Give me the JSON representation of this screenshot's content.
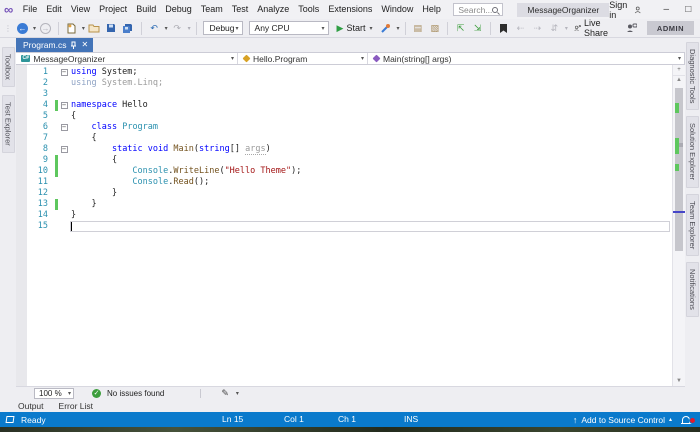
{
  "titlebar": {
    "menus": [
      "File",
      "Edit",
      "View",
      "Project",
      "Build",
      "Debug",
      "Team",
      "Test",
      "Analyze",
      "Tools",
      "Extensions",
      "Window",
      "Help"
    ],
    "search_placeholder": "Search...",
    "solution_badge": "MessageOrganizer",
    "sign_in_label": "Sign in",
    "window_controls": {
      "minimize": "–",
      "maximize": "□",
      "close": "×"
    }
  },
  "toolbar": {
    "config_dropdown": "Debug",
    "platform_dropdown": "Any CPU",
    "start_label": "Start",
    "live_share_label": "Live Share",
    "admin_label": "ADMIN"
  },
  "editor_tab": {
    "label": "Program.cs"
  },
  "navbar": {
    "project": "MessageOrganizer",
    "type": "Hello.Program",
    "member": "Main(string[] args)"
  },
  "side_tabs_left": [
    "Toolbox",
    "Test Explorer"
  ],
  "side_tabs_right": [
    "Diagnostic Tools",
    "Solution Explorer",
    "Team Explorer",
    "Notifications"
  ],
  "editor": {
    "language": "csharp",
    "lines": [
      {
        "n": 1,
        "fold": "minus",
        "tokens": [
          {
            "c": "kw",
            "t": "using"
          },
          {
            "c": "pl",
            "t": " System;"
          }
        ]
      },
      {
        "n": 2,
        "tokens": [
          {
            "c": "kwdim",
            "t": "using"
          },
          {
            "c": "dim",
            "t": " System.Linq;"
          }
        ]
      },
      {
        "n": 3,
        "tokens": []
      },
      {
        "n": 4,
        "fold": "minus",
        "change": true,
        "tokens": [
          {
            "c": "kw",
            "t": "namespace"
          },
          {
            "c": "pl",
            "t": " Hello"
          }
        ]
      },
      {
        "n": 5,
        "tokens": [
          {
            "c": "pl",
            "t": "{"
          }
        ]
      },
      {
        "n": 6,
        "fold": "minus",
        "tokens": [
          {
            "c": "pl",
            "t": "    "
          },
          {
            "c": "kw",
            "t": "class"
          },
          {
            "c": "pl",
            "t": " "
          },
          {
            "c": "ty",
            "t": "Program"
          }
        ]
      },
      {
        "n": 7,
        "tokens": [
          {
            "c": "pl",
            "t": "    {"
          }
        ]
      },
      {
        "n": 8,
        "fold": "minus",
        "tokens": [
          {
            "c": "pl",
            "t": "        "
          },
          {
            "c": "kw",
            "t": "static"
          },
          {
            "c": "pl",
            "t": " "
          },
          {
            "c": "kw",
            "t": "void"
          },
          {
            "c": "pl",
            "t": " "
          },
          {
            "c": "me",
            "t": "Main"
          },
          {
            "c": "pl",
            "t": "("
          },
          {
            "c": "kw",
            "t": "string"
          },
          {
            "c": "pl",
            "t": "[] "
          },
          {
            "c": "dimu",
            "t": "args"
          },
          {
            "c": "pl",
            "t": ")"
          }
        ]
      },
      {
        "n": 9,
        "change": true,
        "tokens": [
          {
            "c": "pl",
            "t": "        {"
          }
        ]
      },
      {
        "n": 10,
        "change": true,
        "tokens": [
          {
            "c": "pl",
            "t": "            "
          },
          {
            "c": "ty",
            "t": "Console"
          },
          {
            "c": "pl",
            "t": "."
          },
          {
            "c": "me",
            "t": "WriteLine"
          },
          {
            "c": "pl",
            "t": "("
          },
          {
            "c": "st",
            "t": "\"Hello Theme\""
          },
          {
            "c": "pl",
            "t": ");"
          }
        ]
      },
      {
        "n": 11,
        "tokens": [
          {
            "c": "pl",
            "t": "            "
          },
          {
            "c": "ty",
            "t": "Console"
          },
          {
            "c": "pl",
            "t": "."
          },
          {
            "c": "me",
            "t": "Read"
          },
          {
            "c": "pl",
            "t": "();"
          }
        ]
      },
      {
        "n": 12,
        "tokens": [
          {
            "c": "pl",
            "t": "        }"
          }
        ]
      },
      {
        "n": 13,
        "change": true,
        "tokens": [
          {
            "c": "pl",
            "t": "    }"
          }
        ]
      },
      {
        "n": 14,
        "tokens": [
          {
            "c": "pl",
            "t": "}"
          }
        ]
      },
      {
        "n": 15,
        "caret": true,
        "tokens": []
      }
    ]
  },
  "editor_footer": {
    "zoom_level": "100 %",
    "issues_text": "No issues found"
  },
  "panel_tabs": [
    "Output",
    "Error List"
  ],
  "statusbar": {
    "ready": "Ready",
    "line": "Ln 15",
    "column": "Col 1",
    "character": "Ch 1",
    "mode": "INS",
    "source_control_label": "Add to Source Control"
  },
  "colors": {
    "accent_blue": "#0a7acc",
    "active_tab_blue": "#4374b8",
    "keyword": "#0000ff",
    "type_name": "#2b91af",
    "method_name": "#74531f",
    "string_literal": "#a31515",
    "change_bar_green": "#5ec75e"
  }
}
